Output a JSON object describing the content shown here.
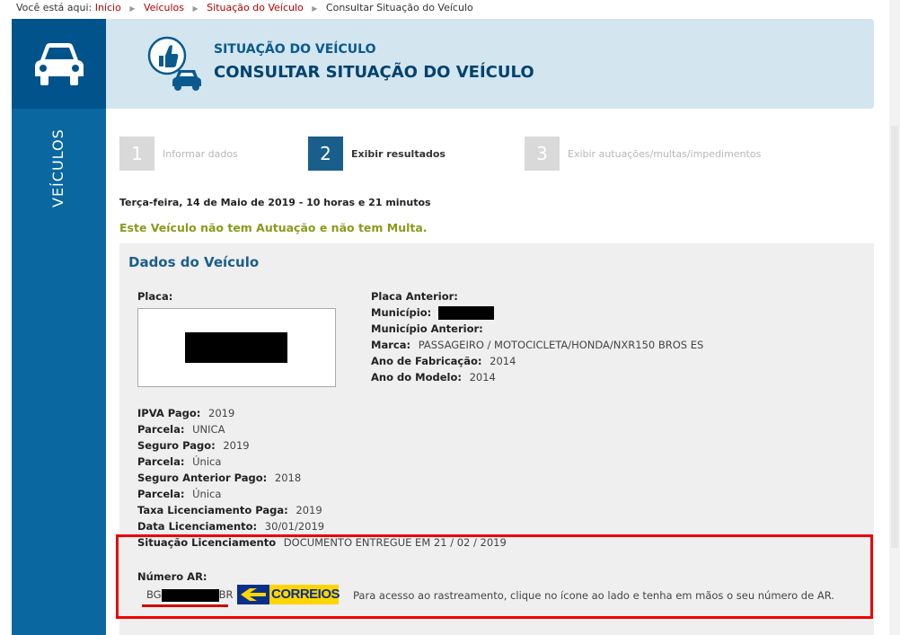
{
  "breadcrumb": {
    "prefix": "Você está aqui:",
    "items": [
      "Início",
      "Veículos",
      "Situação do Veículo"
    ],
    "current": "Consultar Situação do Veículo"
  },
  "sidebar": {
    "label": "VEÍCULOS"
  },
  "header": {
    "subtitle": "SITUAÇÃO DO VEÍCULO",
    "title": "CONSULTAR SITUAÇÃO DO VEÍCULO"
  },
  "steps": [
    {
      "num": "1",
      "label": "Informar dados",
      "state": "inactive"
    },
    {
      "num": "2",
      "label": "Exibir resultados",
      "state": "active"
    },
    {
      "num": "3",
      "label": "Exibir autuações/multas/impedimentos",
      "state": "inactive"
    }
  ],
  "date_line": "Terça-feira, 14 de Maio de 2019 - 10 horas e 21 minutos",
  "status_message": "Este Veículo não tem Autuação e não tem Multa.",
  "vehicle": {
    "section_title": "Dados do Veículo",
    "placa_label": "Placa:",
    "placa_anterior_label": "Placa Anterior:",
    "municipio_label": "Município:",
    "municipio_anterior_label": "Município Anterior:",
    "marca_label": "Marca:",
    "marca_value": "PASSAGEIRO / MOTOCICLETA/HONDA/NXR150 BROS ES",
    "ano_fabricacao_label": "Ano de Fabricação:",
    "ano_fabricacao_value": "2014",
    "ano_modelo_label": "Ano do Modelo:",
    "ano_modelo_value": "2014",
    "ipva_label": "IPVA Pago:",
    "ipva_value": "2019",
    "parcela1_label": "Parcela:",
    "parcela1_value": "UNICA",
    "seguro_label": "Seguro Pago:",
    "seguro_value": "2019",
    "parcela2_label": "Parcela:",
    "parcela2_value": "Única",
    "seguro_ant_label": "Seguro Anterior Pago:",
    "seguro_ant_value": "2018",
    "parcela3_label": "Parcela:",
    "parcela3_value": "Única",
    "taxa_label": "Taxa Licenciamento Paga:",
    "taxa_value": "2019",
    "data_lic_label": "Data Licenciamento:",
    "data_lic_value": "30/01/2019",
    "situacao_label": "Situação Licenciamento",
    "situacao_value": "DOCUMENTO ENTREGUE EM 21 / 02 / 2019",
    "numero_ar_label": "Número AR:",
    "ar_prefix": "BG",
    "ar_suffix": "BR",
    "correios_text": "CORREIOS",
    "ar_hint": "Para acesso ao rastreamento, clique no ícone ao lado e tenha em mãos o seu número de AR."
  },
  "colors": {
    "sidebar": "#0a67a0",
    "header_bg": "#d3e5ef",
    "active_step": "#1a5e8b",
    "success_text": "#8a9a1b",
    "highlight_border": "#e00000",
    "correios_yellow": "#ffd500",
    "correios_blue": "#0b2e8a"
  },
  "icons": [
    "car-icon",
    "thumbs-up-car-icon",
    "correios-logo"
  ]
}
